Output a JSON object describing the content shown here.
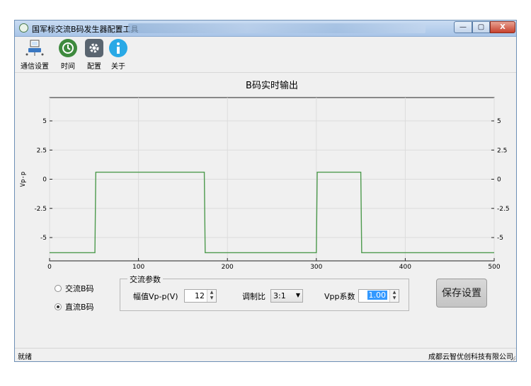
{
  "window": {
    "title": "国军标交流B码发生器配置工具",
    "min_label": "—",
    "max_label": "▢",
    "close_label": "X"
  },
  "toolbar": {
    "items": [
      {
        "label": "通信设置",
        "icon": "network-computer-icon",
        "color": "#3a78c2"
      },
      {
        "label": "时间",
        "icon": "clock-icon",
        "color": "#3e8a3e"
      },
      {
        "label": "配置",
        "icon": "gear-icon",
        "color": "#5a6570"
      },
      {
        "label": "关于",
        "icon": "info-icon",
        "color": "#29a9e6"
      }
    ]
  },
  "chart_data": {
    "type": "line",
    "title": "B码实时输出",
    "xlabel": "",
    "ylabel": "Vp-p",
    "xlim": [
      0,
      500
    ],
    "ylim": [
      -7,
      7
    ],
    "x_ticks": [
      0,
      100,
      200,
      300,
      400,
      500
    ],
    "y_ticks": [
      5,
      2.5,
      0,
      -2.5,
      -5
    ],
    "y_tick_labels": [
      "5",
      "2.5",
      "0",
      "-2.5",
      "-5"
    ],
    "grid": true,
    "line_color": "#4d9a4d",
    "series": [
      {
        "x": [
          0,
          51,
          52,
          174,
          175,
          300,
          301,
          350,
          351,
          500
        ],
        "y": [
          -6.3,
          -6.3,
          0.6,
          0.6,
          -6.3,
          -6.3,
          0.6,
          0.6,
          -6.3,
          -6.3
        ]
      }
    ]
  },
  "mode": {
    "options": [
      {
        "label": "交流B码",
        "checked": false
      },
      {
        "label": "直流B码",
        "checked": true
      }
    ]
  },
  "ac_params": {
    "group_title": "交流参数",
    "amplitude_label": "幅值Vp-p(V)",
    "amplitude_value": "12",
    "mod_ratio_label": "调制比",
    "mod_ratio_value": "3:1",
    "vpp_coef_label": "Vpp系数",
    "vpp_coef_value": "1.00"
  },
  "save_button": "保存设置",
  "status": {
    "left": "就绪",
    "right": "成都云智优创科技有限公司"
  }
}
